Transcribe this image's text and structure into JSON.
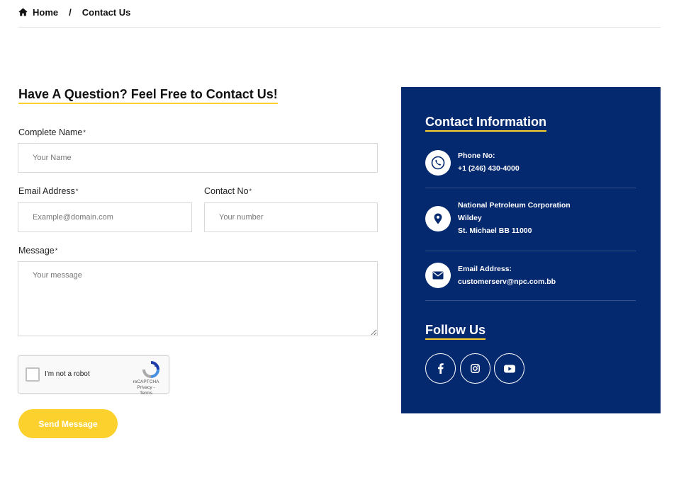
{
  "breadcrumb": {
    "home": "Home",
    "separator": "/",
    "current": "Contact Us"
  },
  "form": {
    "title": "Have A Question? Feel Free to Contact Us!",
    "name_label": "Complete Name",
    "name_placeholder": "Your Name",
    "email_label": "Email Address",
    "email_placeholder": "Example@domain.com",
    "contact_label": "Contact No",
    "contact_placeholder": "Your number",
    "message_label": "Message",
    "message_placeholder": "Your message",
    "required_mark": "*",
    "submit_label": "Send Message"
  },
  "captcha": {
    "label": "I'm not a robot",
    "brand": "reCAPTCHA",
    "links": "Privacy - Terms"
  },
  "contact_info": {
    "title": "Contact Information",
    "phone_label": "Phone No:",
    "phone_value": "+1 (246) 430-4000",
    "address_line1": "National Petroleum Corporation",
    "address_line2": "Wildey",
    "address_line3": "St. Michael BB 11000",
    "email_label": "Email Address:",
    "email_value": "customerserv@npc.com.bb"
  },
  "follow": {
    "title": "Follow Us",
    "icons": [
      "facebook-icon",
      "instagram-icon",
      "youtube-icon"
    ]
  },
  "colors": {
    "panel_bg": "#05296f",
    "accent": "#fcd12e"
  }
}
